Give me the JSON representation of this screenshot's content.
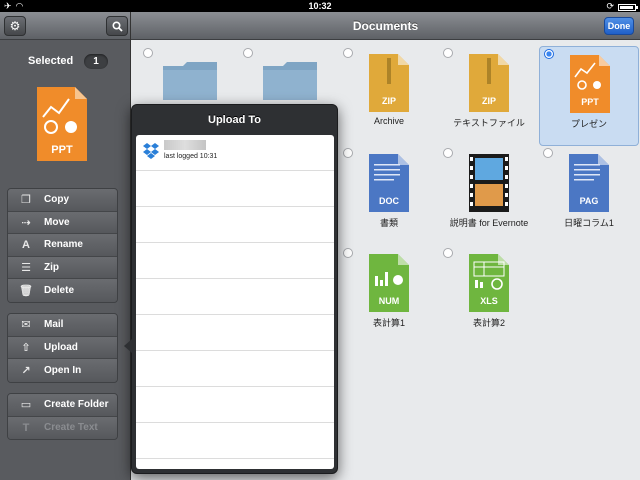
{
  "status": {
    "time": "10:32",
    "battery_level": 0.8
  },
  "sidebar": {
    "selected_label": "Selected",
    "selected_count": "1",
    "preview_type": "PPT",
    "groups": [
      [
        {
          "label": "Copy",
          "icon": "copy-icon",
          "disabled": false
        },
        {
          "label": "Move",
          "icon": "move-icon",
          "disabled": false
        },
        {
          "label": "Rename",
          "icon": "rename-icon",
          "disabled": false
        },
        {
          "label": "Zip",
          "icon": "zip-icon",
          "disabled": false
        },
        {
          "label": "Delete",
          "icon": "trash-icon",
          "disabled": false
        }
      ],
      [
        {
          "label": "Mail",
          "icon": "mail-icon",
          "disabled": false
        },
        {
          "label": "Upload",
          "icon": "upload-icon",
          "disabled": false
        },
        {
          "label": "Open In",
          "icon": "open-in-icon",
          "disabled": false
        }
      ],
      [
        {
          "label": "Create Folder",
          "icon": "create-folder-icon",
          "disabled": false
        },
        {
          "label": "Create Text",
          "icon": "create-text-icon",
          "disabled": true
        }
      ]
    ]
  },
  "navbar": {
    "title": "Documents",
    "done_label": "Done"
  },
  "files": [
    {
      "label": "",
      "type": "FOLDER",
      "selected": false
    },
    {
      "label": "",
      "type": "FOLDER",
      "selected": false
    },
    {
      "label": "Archive",
      "type": "ZIP",
      "selected": false
    },
    {
      "label": "テキストファイル",
      "type": "ZIP",
      "selected": false
    },
    {
      "label": "プレゼン",
      "type": "PPT",
      "selected": true
    },
    {
      "label": "",
      "type": "",
      "selected": false
    },
    {
      "label": "",
      "type": "",
      "selected": false
    },
    {
      "label": "書類",
      "type": "DOC",
      "selected": false
    },
    {
      "label": "説明書 for Evernote",
      "type": "VIDEO",
      "selected": false
    },
    {
      "label": "日曜コラム1",
      "type": "PAG",
      "selected": false
    },
    {
      "label": "",
      "type": "",
      "selected": false
    },
    {
      "label": "",
      "type": "",
      "selected": false
    },
    {
      "label": "表計算1",
      "type": "NUM",
      "selected": false
    },
    {
      "label": "表計算2",
      "type": "XLS",
      "selected": false
    }
  ],
  "popover": {
    "title": "Upload To",
    "account": {
      "last_logged": "last logged 10:31"
    },
    "empty_rows": 8
  },
  "colors": {
    "ppt": "#f08c2a",
    "zip": "#e0a93a",
    "doc": "#4b77c4",
    "pag": "#4b77c4",
    "num": "#6fb63f",
    "xls": "#6fb63f",
    "folder": "#8fb2cf",
    "accent": "#1e6be0"
  }
}
